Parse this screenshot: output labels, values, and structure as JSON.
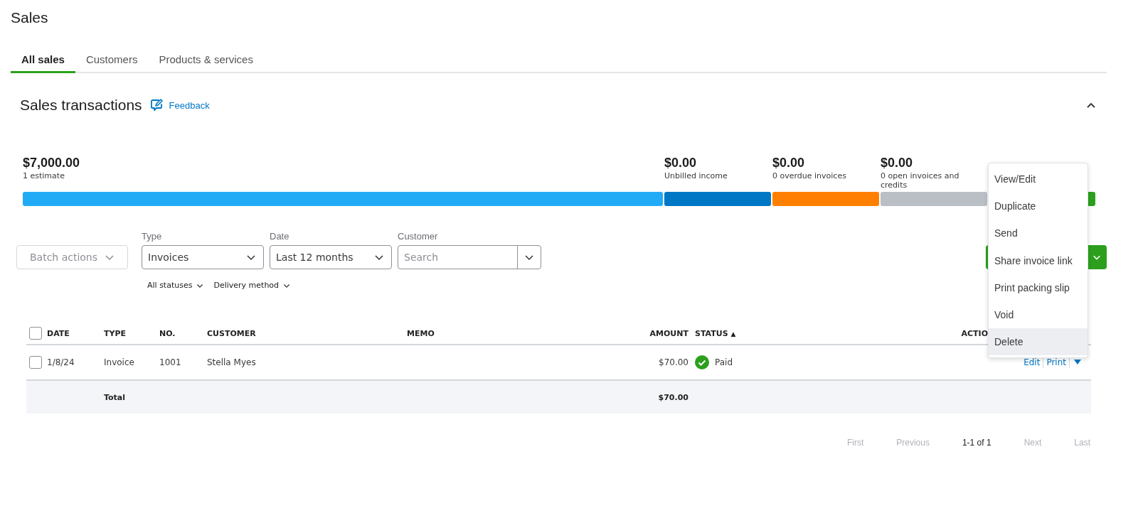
{
  "page_title": "Sales",
  "tabs": [
    {
      "label": "All sales",
      "selected": true
    },
    {
      "label": "Customers",
      "selected": false
    },
    {
      "label": "Products & services",
      "selected": false
    }
  ],
  "section": {
    "title": "Sales transactions",
    "feedback_link": "Feedback",
    "expanded": true
  },
  "summary": [
    {
      "amount": "$7,000.00",
      "label": "1 estimate",
      "color": "#21abf6"
    },
    {
      "amount": "$0.00",
      "label": "Unbilled income",
      "color": "#0077c5"
    },
    {
      "amount": "$0.00",
      "label": "0 overdue invoices",
      "color": "#ff8000"
    },
    {
      "amount": "$0.00",
      "label": "0 open invoices and credits",
      "color": "#babec5"
    },
    {
      "color": "#2ca01c"
    }
  ],
  "filters": {
    "batch_actions": {
      "label": "Batch actions",
      "disabled": true
    },
    "type": {
      "label": "Type",
      "value": "Invoices"
    },
    "date": {
      "label": "Date",
      "value": "Last 12 months"
    },
    "customer": {
      "label": "Customer",
      "placeholder": "Search"
    },
    "sub_filters": [
      "All statuses",
      "Delivery method"
    ]
  },
  "table": {
    "select_all_checked": false,
    "columns": [
      {
        "label": "DATE"
      },
      {
        "label": "TYPE"
      },
      {
        "label": "NO."
      },
      {
        "label": "CUSTOMER"
      },
      {
        "label": "MEMO"
      },
      {
        "label": "AMOUNT"
      },
      {
        "label": "STATUS",
        "sort_mark": "▲"
      },
      {
        "label": "ACTIO"
      }
    ],
    "rows": [
      {
        "checked": false,
        "date": "1/8/24",
        "type": "Invoice",
        "no": "1001",
        "customer": "Stella Myes",
        "amount": "$70.00",
        "status": "Paid",
        "actions": [
          "Edit",
          "Print"
        ]
      }
    ],
    "total": {
      "label": "Total",
      "amount": "$70.00"
    }
  },
  "pagination": {
    "first": "First",
    "previous": "Previous",
    "range": "1-1 of 1",
    "next": "Next",
    "last": "Last"
  },
  "context_menu": [
    {
      "label": "View/Edit",
      "selected": false
    },
    {
      "label": "Duplicate",
      "selected": false
    },
    {
      "label": "Send",
      "selected": false
    },
    {
      "label": "Share invoice link",
      "selected": false
    },
    {
      "label": "Print packing slip",
      "selected": false
    },
    {
      "label": "Void",
      "selected": false
    },
    {
      "label": "Delete",
      "selected": true
    }
  ]
}
